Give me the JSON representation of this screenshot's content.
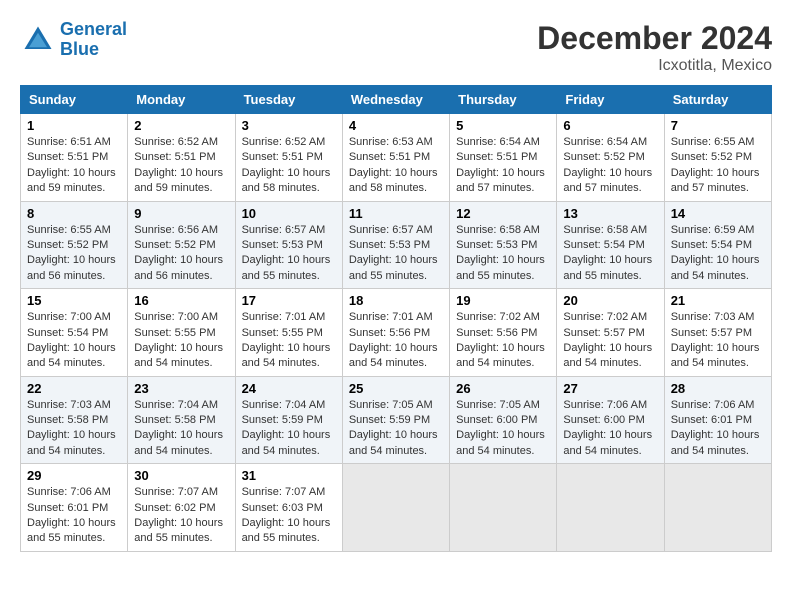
{
  "logo": {
    "text_general": "General",
    "text_blue": "Blue"
  },
  "title": {
    "month_year": "December 2024",
    "location": "Icxotitla, Mexico"
  },
  "headers": [
    "Sunday",
    "Monday",
    "Tuesday",
    "Wednesday",
    "Thursday",
    "Friday",
    "Saturday"
  ],
  "weeks": [
    [
      {
        "day": "1",
        "sunrise": "6:51 AM",
        "sunset": "5:51 PM",
        "daylight": "10 hours and 59 minutes."
      },
      {
        "day": "2",
        "sunrise": "6:52 AM",
        "sunset": "5:51 PM",
        "daylight": "10 hours and 59 minutes."
      },
      {
        "day": "3",
        "sunrise": "6:52 AM",
        "sunset": "5:51 PM",
        "daylight": "10 hours and 58 minutes."
      },
      {
        "day": "4",
        "sunrise": "6:53 AM",
        "sunset": "5:51 PM",
        "daylight": "10 hours and 58 minutes."
      },
      {
        "day": "5",
        "sunrise": "6:54 AM",
        "sunset": "5:51 PM",
        "daylight": "10 hours and 57 minutes."
      },
      {
        "day": "6",
        "sunrise": "6:54 AM",
        "sunset": "5:52 PM",
        "daylight": "10 hours and 57 minutes."
      },
      {
        "day": "7",
        "sunrise": "6:55 AM",
        "sunset": "5:52 PM",
        "daylight": "10 hours and 57 minutes."
      }
    ],
    [
      {
        "day": "8",
        "sunrise": "6:55 AM",
        "sunset": "5:52 PM",
        "daylight": "10 hours and 56 minutes."
      },
      {
        "day": "9",
        "sunrise": "6:56 AM",
        "sunset": "5:52 PM",
        "daylight": "10 hours and 56 minutes."
      },
      {
        "day": "10",
        "sunrise": "6:57 AM",
        "sunset": "5:53 PM",
        "daylight": "10 hours and 55 minutes."
      },
      {
        "day": "11",
        "sunrise": "6:57 AM",
        "sunset": "5:53 PM",
        "daylight": "10 hours and 55 minutes."
      },
      {
        "day": "12",
        "sunrise": "6:58 AM",
        "sunset": "5:53 PM",
        "daylight": "10 hours and 55 minutes."
      },
      {
        "day": "13",
        "sunrise": "6:58 AM",
        "sunset": "5:54 PM",
        "daylight": "10 hours and 55 minutes."
      },
      {
        "day": "14",
        "sunrise": "6:59 AM",
        "sunset": "5:54 PM",
        "daylight": "10 hours and 54 minutes."
      }
    ],
    [
      {
        "day": "15",
        "sunrise": "7:00 AM",
        "sunset": "5:54 PM",
        "daylight": "10 hours and 54 minutes."
      },
      {
        "day": "16",
        "sunrise": "7:00 AM",
        "sunset": "5:55 PM",
        "daylight": "10 hours and 54 minutes."
      },
      {
        "day": "17",
        "sunrise": "7:01 AM",
        "sunset": "5:55 PM",
        "daylight": "10 hours and 54 minutes."
      },
      {
        "day": "18",
        "sunrise": "7:01 AM",
        "sunset": "5:56 PM",
        "daylight": "10 hours and 54 minutes."
      },
      {
        "day": "19",
        "sunrise": "7:02 AM",
        "sunset": "5:56 PM",
        "daylight": "10 hours and 54 minutes."
      },
      {
        "day": "20",
        "sunrise": "7:02 AM",
        "sunset": "5:57 PM",
        "daylight": "10 hours and 54 minutes."
      },
      {
        "day": "21",
        "sunrise": "7:03 AM",
        "sunset": "5:57 PM",
        "daylight": "10 hours and 54 minutes."
      }
    ],
    [
      {
        "day": "22",
        "sunrise": "7:03 AM",
        "sunset": "5:58 PM",
        "daylight": "10 hours and 54 minutes."
      },
      {
        "day": "23",
        "sunrise": "7:04 AM",
        "sunset": "5:58 PM",
        "daylight": "10 hours and 54 minutes."
      },
      {
        "day": "24",
        "sunrise": "7:04 AM",
        "sunset": "5:59 PM",
        "daylight": "10 hours and 54 minutes."
      },
      {
        "day": "25",
        "sunrise": "7:05 AM",
        "sunset": "5:59 PM",
        "daylight": "10 hours and 54 minutes."
      },
      {
        "day": "26",
        "sunrise": "7:05 AM",
        "sunset": "6:00 PM",
        "daylight": "10 hours and 54 minutes."
      },
      {
        "day": "27",
        "sunrise": "7:06 AM",
        "sunset": "6:00 PM",
        "daylight": "10 hours and 54 minutes."
      },
      {
        "day": "28",
        "sunrise": "7:06 AM",
        "sunset": "6:01 PM",
        "daylight": "10 hours and 54 minutes."
      }
    ],
    [
      {
        "day": "29",
        "sunrise": "7:06 AM",
        "sunset": "6:01 PM",
        "daylight": "10 hours and 55 minutes."
      },
      {
        "day": "30",
        "sunrise": "7:07 AM",
        "sunset": "6:02 PM",
        "daylight": "10 hours and 55 minutes."
      },
      {
        "day": "31",
        "sunrise": "7:07 AM",
        "sunset": "6:03 PM",
        "daylight": "10 hours and 55 minutes."
      },
      null,
      null,
      null,
      null
    ]
  ]
}
